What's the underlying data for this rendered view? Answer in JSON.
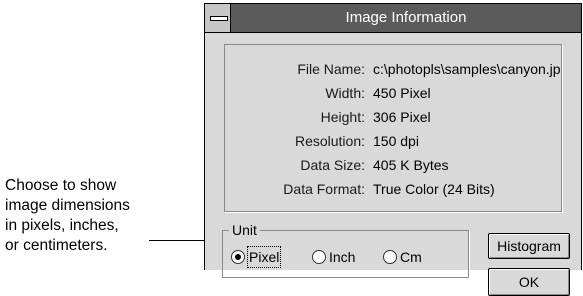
{
  "callout": {
    "lines": [
      "Choose to show",
      "image dimensions",
      "in pixels, inches,",
      "or centimeters."
    ]
  },
  "dialog": {
    "title": "Image Information",
    "info_rows": [
      {
        "label": "File Name:",
        "value": "c:\\photopls\\samples\\canyon.jp"
      },
      {
        "label": "Width:",
        "value": "450 Pixel"
      },
      {
        "label": "Height:",
        "value": "306 Pixel"
      },
      {
        "label": "Resolution:",
        "value": "150 dpi"
      },
      {
        "label": "Data Size:",
        "value": "405 K Bytes"
      },
      {
        "label": "Data Format:",
        "value": "True Color (24 Bits)"
      }
    ],
    "unit": {
      "legend": "Unit",
      "options": [
        {
          "label": "Pixel",
          "selected": true
        },
        {
          "label": "Inch",
          "selected": false
        },
        {
          "label": "Cm",
          "selected": false
        }
      ]
    },
    "buttons": {
      "histogram": "Histogram",
      "ok": "OK"
    }
  }
}
